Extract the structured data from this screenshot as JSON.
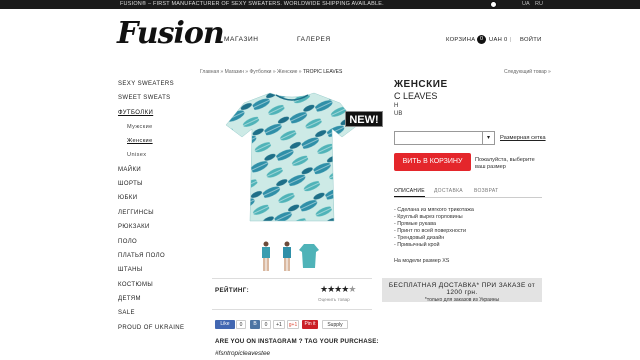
{
  "topbar": {
    "message": "FUSION® – FIRST MANUFACTURER OF SEXY SWEATERS. WORLDWIDE SHIPPING AVAILABLE.",
    "lang_ua": "UA",
    "lang_ru": "RU"
  },
  "header": {
    "logo": "Fusion",
    "nav": [
      "МАГАЗИН",
      "ГАЛЕРЕЯ"
    ],
    "cart_label": "КОРЗИНА",
    "cart_count": "0",
    "cart_total": "UAH 0",
    "login": "ВОЙТИ"
  },
  "sidebar": {
    "items": [
      {
        "label": "SEXY SWEATERS"
      },
      {
        "label": "SWEET SWEATS"
      },
      {
        "label": "ФУТБОЛКИ"
      },
      {
        "label": "Мужские"
      },
      {
        "label": "Женские"
      },
      {
        "label": "Unisex"
      },
      {
        "label": "МАЙКИ"
      },
      {
        "label": "ШОРТЫ"
      },
      {
        "label": "ЮБКИ"
      },
      {
        "label": "ЛЕГГИНСЫ"
      },
      {
        "label": "РЮКЗАКИ"
      },
      {
        "label": "ПОЛО"
      },
      {
        "label": "ПЛАТЬЯ ПОЛО"
      },
      {
        "label": "ШТАНЫ"
      },
      {
        "label": "КОСТЮМЫ"
      },
      {
        "label": "ДЕТЯМ"
      },
      {
        "label": "SALE"
      },
      {
        "label": "PROUD OF UKRAINE"
      }
    ]
  },
  "breadcrumb": {
    "items": [
      "Главная",
      "Магазин",
      "Футболки",
      "Женские"
    ],
    "current": "TROPIC LEAVES",
    "next": "Следующий товар"
  },
  "product": {
    "new_badge": "NEW!",
    "title": "ЖЕНСКИЕ",
    "subtitle": "C LEAVES",
    "code": "H",
    "price": "UB",
    "size_link": "Размерная сетка",
    "buy_button": "ВИТЬ В КОРЗИНУ",
    "hint": "Пожалуйста, выберите ваш размер",
    "tabs": [
      "ОПИСАНИЕ",
      "ДОСТАВКА",
      "ВОЗВРАТ"
    ],
    "description": [
      "- Сделана из мягкого трикотажа",
      "- Круглый вырез горловины",
      "- Прямые рукава",
      "- Принт по всей поверхности",
      "- Трендовый дизайн",
      "- Привычный крой"
    ],
    "model_note": "На модели размер XS"
  },
  "shipping": {
    "line1": "БЕСПЛАТНАЯ ДОСТАВКА* ПРИ ЗАКАЗЕ от 1200 грн.",
    "line2": "*только для заказов из Украины"
  },
  "rating": {
    "label": "РЕЙТИНГ:",
    "stars": 4.5,
    "max": 5,
    "link": "Оценить товар"
  },
  "share": {
    "like": "Like",
    "like_count": "0",
    "vk": "В",
    "vk_count": "0",
    "plus": "+1",
    "gplus": "g+1",
    "pin": "Pin it",
    "supply": "Supply"
  },
  "instagram": {
    "prompt": "ARE YOU ON INSTAGRAM ? TAG YOUR PURCHASE:",
    "hashtag": "#fsntropicleavestee"
  },
  "colors": {
    "accent": "#e4262b",
    "print_teal": "#2f8fa8",
    "print_light": "#bfe6e4"
  }
}
